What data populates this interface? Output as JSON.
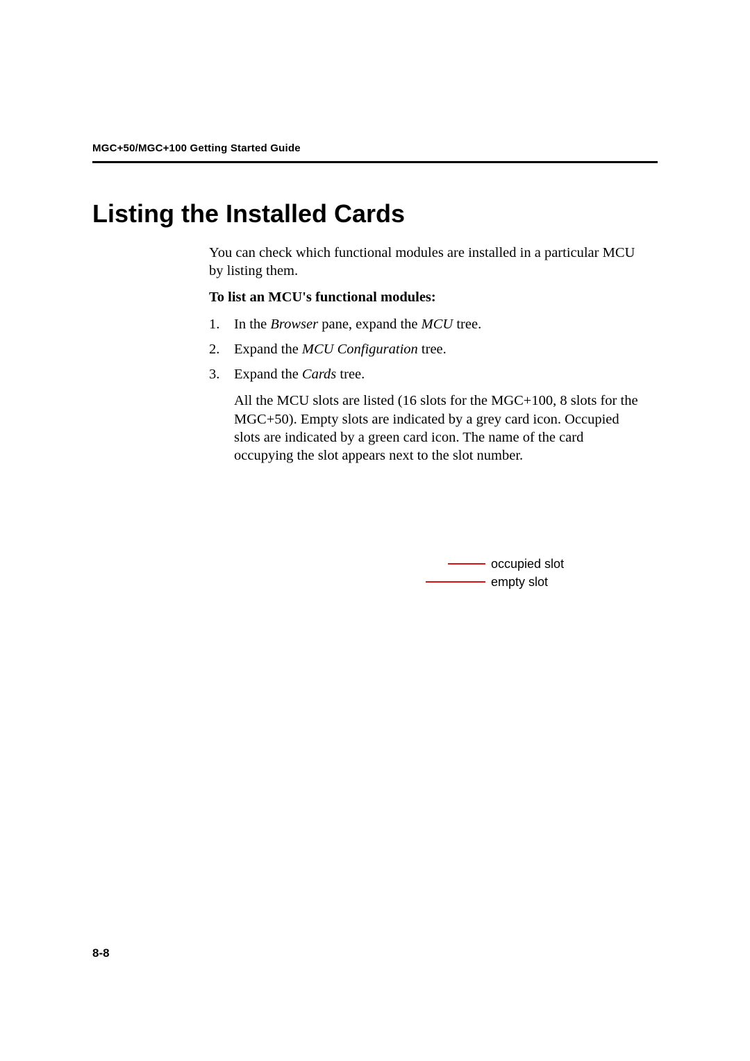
{
  "header": {
    "running_head": "MGC+50/MGC+100 Getting Started Guide"
  },
  "title": "Listing the Installed Cards",
  "intro": {
    "pre": "You can check which functional modules are installed in a particular MCU by listing them."
  },
  "task_label": "To list an MCU's functional modules:",
  "steps": {
    "s1": {
      "pre": "In the ",
      "i1": "Browser",
      "mid": " pane, expand the ",
      "i2": "MCU",
      "post": " tree."
    },
    "s2": {
      "pre": "Expand the ",
      "i1": "MCU Configuration",
      "post": " tree."
    },
    "s3": {
      "pre": "Expand the ",
      "i1": "Cards",
      "post": " tree."
    },
    "s3_follow": "All the MCU slots are listed (16 slots for the MGC+100, 8 slots for the MGC+50). Empty slots are indicated by a grey card icon. Occupied slots are indicated by a green card icon. The name of the card occupying the slot appears next to the slot number."
  },
  "legend": {
    "occupied": "occupied slot",
    "empty": "empty slot"
  },
  "page_number": "8-8"
}
